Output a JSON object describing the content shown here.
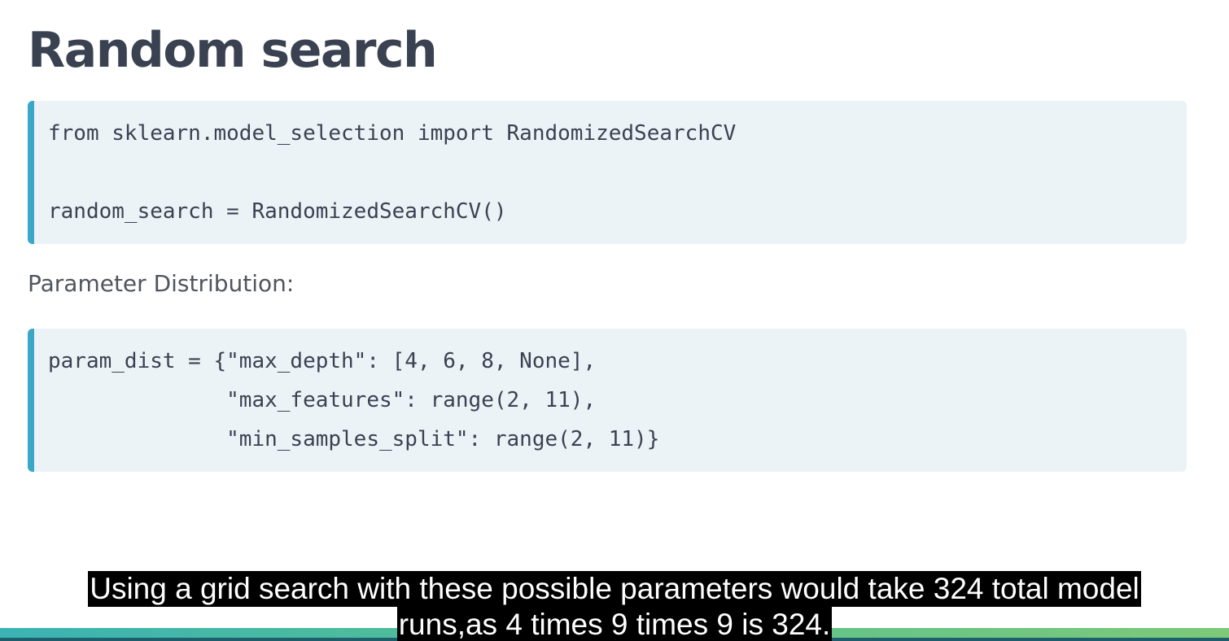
{
  "slide": {
    "title": "Random search",
    "code_block_1": {
      "lines": [
        "from sklearn.model_selection import RandomizedSearchCV",
        "",
        "random_search = RandomizedSearchCV()"
      ]
    },
    "paragraph": "Parameter Distribution:",
    "code_block_2": {
      "lines": [
        "param_dist = {\"max_depth\": [4, 6, 8, None],",
        "              \"max_features\": range(2, 11),",
        "              \"min_samples_split\": range(2, 11)}"
      ]
    }
  },
  "subtitle": {
    "lines": [
      "Using a grid search with these possible parameters would take 324 total model",
      "runs,as 4 times 9 times 9 is 324."
    ]
  },
  "colors": {
    "code_border": "#3ba7c6",
    "code_background": "#ebf3f7",
    "title_text": "#3a4252",
    "bottom_bar_start": "#3bb3b4",
    "bottom_bar_end": "#7dc97a"
  }
}
